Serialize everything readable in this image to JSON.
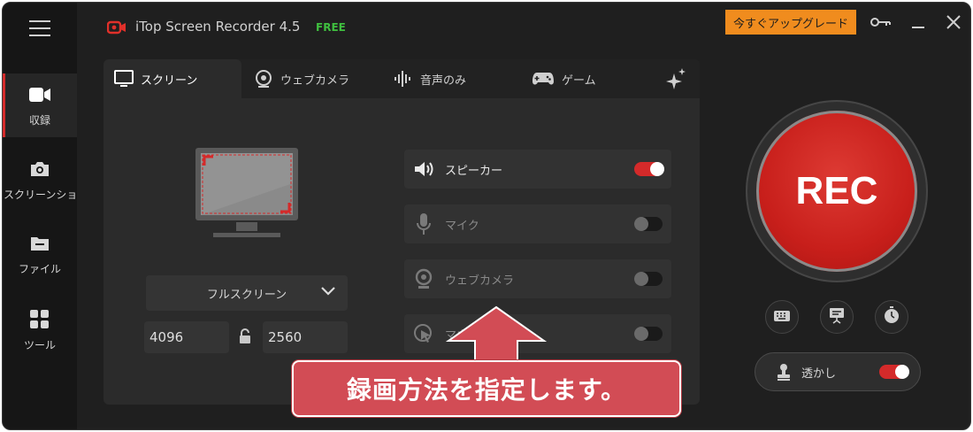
{
  "app": {
    "title": "iTop Screen Recorder 4.5",
    "free_badge": "FREE",
    "upgrade_label": "今すぐアップグレード"
  },
  "sidebar": {
    "items": [
      {
        "label": "収録",
        "icon": "video-camera-icon",
        "active": true
      },
      {
        "label": "スクリーンショ…",
        "icon": "camera-icon",
        "active": false
      },
      {
        "label": "ファイル",
        "icon": "folder-icon",
        "active": false
      },
      {
        "label": "ツール",
        "icon": "grid-icon",
        "active": false
      }
    ]
  },
  "tabs": [
    {
      "label": "スクリーン",
      "icon": "monitor-icon",
      "active": true
    },
    {
      "label": "ウェブカメラ",
      "icon": "webcam-icon",
      "active": false
    },
    {
      "label": "音声のみ",
      "icon": "audio-wave-icon",
      "active": false
    },
    {
      "label": "ゲーム",
      "icon": "gamepad-icon",
      "active": false
    }
  ],
  "capture": {
    "mode": "フルスクリーン",
    "width": "4096",
    "height": "2560"
  },
  "audio_rows": [
    {
      "label": "スピーカー",
      "icon": "speaker-icon",
      "on": true
    },
    {
      "label": "マイク",
      "icon": "microphone-icon",
      "on": false
    },
    {
      "label": "ウェブカメラ",
      "icon": "webcam-icon",
      "on": false
    },
    {
      "label": "マウス",
      "icon": "mouse-click-icon",
      "on": false
    }
  ],
  "rec_label": "REC",
  "watermark_label": "透かし",
  "callout_text": "録画方法を指定します。",
  "colors": {
    "accent_red": "#d42a2a",
    "upgrade_orange": "#f08c1e",
    "free_green": "#3fbf3f",
    "callout_red": "#d24c55"
  }
}
